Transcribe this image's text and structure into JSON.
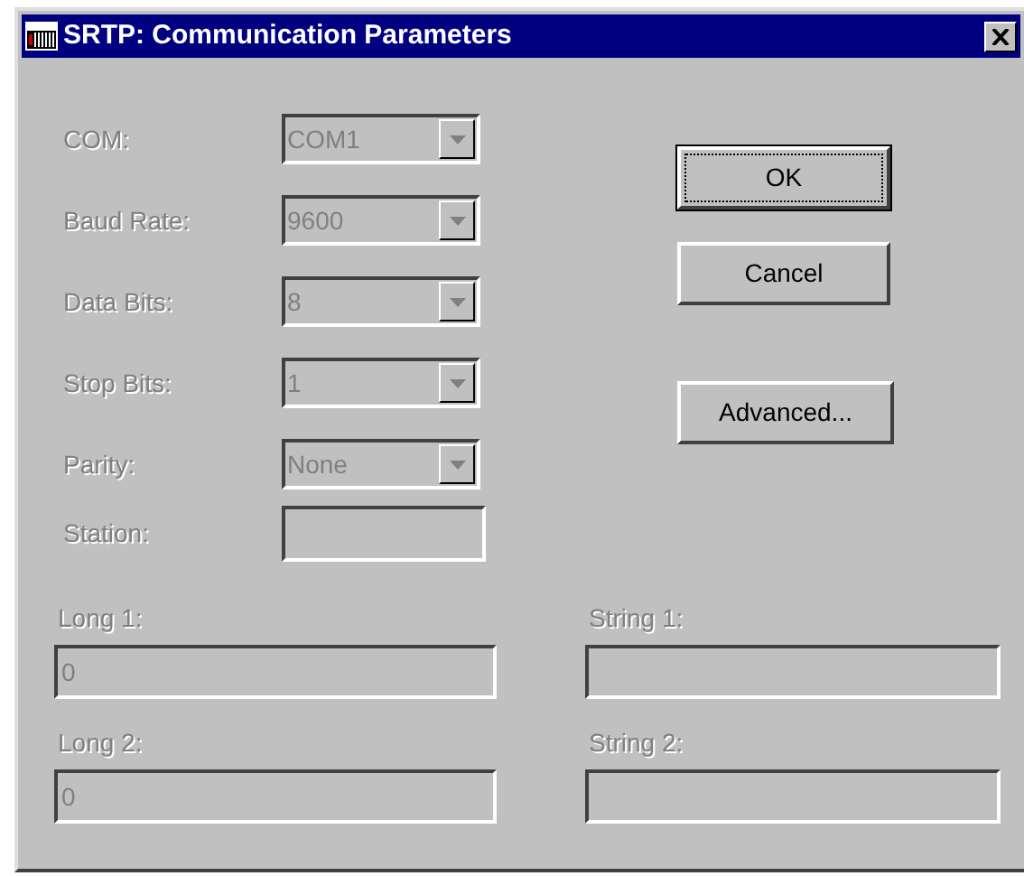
{
  "window": {
    "title": "SRTP: Communication Parameters"
  },
  "settings": [
    {
      "label": "COM:",
      "kind": "combo",
      "value": "COM1",
      "disabled": true
    },
    {
      "label": "Baud Rate:",
      "kind": "combo",
      "value": "9600",
      "disabled": true
    },
    {
      "label": "Data Bits:",
      "kind": "combo",
      "value": "8",
      "disabled": true
    },
    {
      "label": "Stop Bits:",
      "kind": "combo",
      "value": "1",
      "disabled": true
    },
    {
      "label": "Parity:",
      "kind": "combo",
      "value": "None",
      "disabled": true
    },
    {
      "label": "Station:",
      "kind": "text",
      "disabled": true
    }
  ],
  "buttons": [
    {
      "label": "OK",
      "default": true
    },
    {
      "label": "Cancel",
      "default": false
    },
    {
      "label": "Advanced...",
      "default": false
    }
  ],
  "values": [
    {
      "label": "Long 1:",
      "value": "0",
      "disabled": true
    },
    {
      "label": "String 1:",
      "disabled": true
    },
    {
      "label": "Long 2:",
      "value": "0",
      "disabled": true
    },
    {
      "label": "String 2:",
      "disabled": true
    }
  ]
}
